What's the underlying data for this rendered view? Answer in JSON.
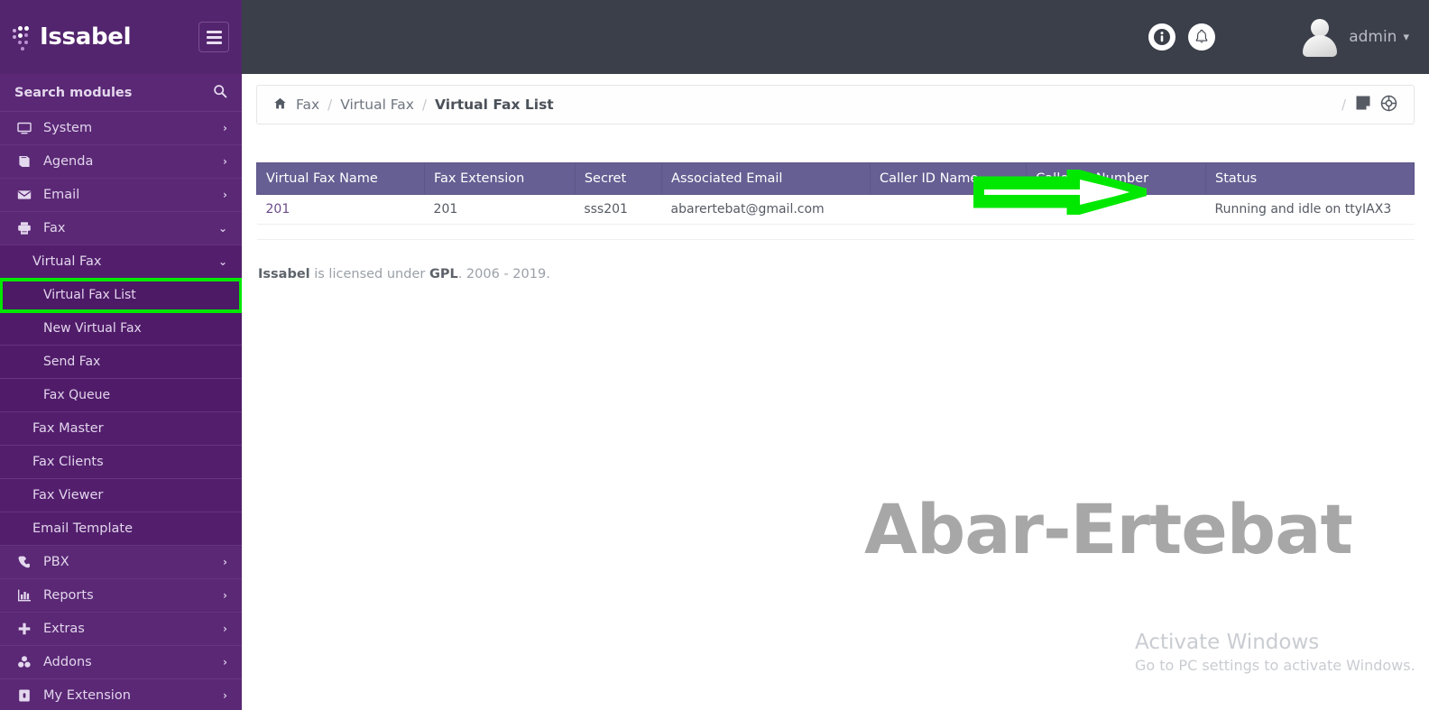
{
  "brand": {
    "name": "Issabel",
    "logo_icon": "issabel-dots-logo",
    "menu_toggle_icon": "hamburger-icon"
  },
  "topbar": {
    "info_icon": "info-circle-icon",
    "notification_icon": "bell-icon",
    "user_name": "admin",
    "user_caret_icon": "chevron-down-icon",
    "avatar_icon": "user-avatar-icon"
  },
  "sidebar": {
    "search_placeholder": "Search modules",
    "search_icon": "search-icon",
    "items": [
      {
        "label": "System",
        "icon": "desktop-icon",
        "chevron": "chevron-right-icon",
        "level": 0
      },
      {
        "label": "Agenda",
        "icon": "book-icon",
        "chevron": "chevron-right-icon",
        "level": 0
      },
      {
        "label": "Email",
        "icon": "envelope-icon",
        "chevron": "chevron-right-icon",
        "level": 0
      },
      {
        "label": "Fax",
        "icon": "printer-icon",
        "chevron": "chevron-down-icon",
        "level": 0,
        "expanded": true
      },
      {
        "label": "Virtual Fax",
        "icon": "",
        "chevron": "chevron-down-icon",
        "level": 1,
        "expanded": true
      },
      {
        "label": "Virtual Fax List",
        "icon": "",
        "chevron": "",
        "level": 2,
        "highlighted": true
      },
      {
        "label": "New Virtual Fax",
        "icon": "",
        "chevron": "",
        "level": 2
      },
      {
        "label": "Send Fax",
        "icon": "",
        "chevron": "",
        "level": 2
      },
      {
        "label": "Fax Queue",
        "icon": "",
        "chevron": "",
        "level": 2
      },
      {
        "label": "Fax Master",
        "icon": "",
        "chevron": "",
        "level": 1
      },
      {
        "label": "Fax Clients",
        "icon": "",
        "chevron": "",
        "level": 1
      },
      {
        "label": "Fax Viewer",
        "icon": "",
        "chevron": "",
        "level": 1
      },
      {
        "label": "Email Template",
        "icon": "",
        "chevron": "",
        "level": 1
      },
      {
        "label": "PBX",
        "icon": "phone-icon",
        "chevron": "chevron-right-icon",
        "level": 0
      },
      {
        "label": "Reports",
        "icon": "bar-chart-icon",
        "chevron": "chevron-right-icon",
        "level": 0
      },
      {
        "label": "Extras",
        "icon": "plus-icon",
        "chevron": "chevron-right-icon",
        "level": 0
      },
      {
        "label": "Addons",
        "icon": "cubes-icon",
        "chevron": "chevron-right-icon",
        "level": 0
      },
      {
        "label": "My Extension",
        "icon": "lock-icon",
        "chevron": "chevron-right-icon",
        "level": 0
      }
    ]
  },
  "breadcrumb": {
    "home_icon": "home-icon",
    "item1": "Fax",
    "sep": "/",
    "item2": "Virtual Fax",
    "current": "Virtual Fax List",
    "right_slash": "/",
    "window_icon": "window-icon",
    "globe_icon": "globe-icon"
  },
  "table": {
    "headers": [
      "Virtual Fax Name",
      "Fax Extension",
      "Secret",
      "Associated Email",
      "Caller ID Name",
      "Caller ID Number",
      "Status"
    ],
    "rows": [
      {
        "virtual_fax_name": "201",
        "fax_extension": "201",
        "secret": "sss201",
        "associated_email": "abarertebat@gmail.com",
        "caller_id_name": "",
        "caller_id_number": "",
        "status": "Running and idle on ttyIAX3"
      }
    ]
  },
  "footer": {
    "brand": "Issabel",
    "text_mid": " is licensed under ",
    "license": "GPL",
    "years": ". 2006 - 2019."
  },
  "watermarks": {
    "brand": "Abar-Ertebat",
    "windows_title": "Activate Windows",
    "windows_sub": "Go to PC settings to activate Windows."
  },
  "annotation": {
    "arrow_icon": "green-arrow-annotation",
    "arrow_color": "#00e800",
    "highlight_color": "#00e800"
  },
  "colors": {
    "sidebar_bg": "#5a2875",
    "brand_bg": "#53256e",
    "topbar_bg": "#3b3f4a",
    "table_header_bg": "#665f93",
    "accent_green": "#00e800"
  }
}
